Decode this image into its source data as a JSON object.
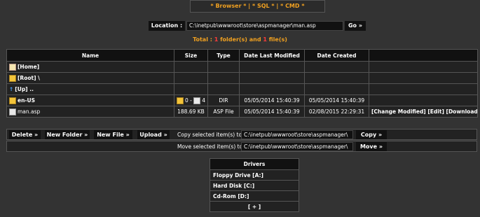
{
  "nav": {
    "browser": "* Browser *",
    "sep1": " | ",
    "sql": "* SQL *",
    "sep2": " | ",
    "cmd": "* CMD *"
  },
  "location": {
    "label": "Location :",
    "value": "C:\\inetpub\\wwwroot\\store\\aspmanager\\man.asp",
    "go": "Go »"
  },
  "total": {
    "prefix": "Total : ",
    "folders": "1",
    "mid": " folder(s) and ",
    "files": "1",
    "suffix": " file(s)"
  },
  "table": {
    "headers": [
      "Name",
      "Size",
      "Type",
      "Date Last Modified",
      "Date Created",
      ""
    ],
    "nav_rows": [
      "[Home]",
      "[Root] \\",
      "[Up] .."
    ],
    "rows": [
      {
        "name": "en-US",
        "size_folders": "0",
        "size_sep": " - ",
        "size_files": "4",
        "type": "DIR",
        "modified": "05/05/2014 15:40:39",
        "created": "05/05/2014 15:40:39",
        "actions": []
      },
      {
        "name": "man.asp",
        "size": "188.69 KB",
        "type": "ASP File",
        "modified": "05/05/2014 15:40:39",
        "created": "02/08/2015 22:29:31",
        "actions": [
          "[Change Modified]",
          "[Edit]",
          "[Download]"
        ]
      }
    ]
  },
  "ops": {
    "delete": "Delete »",
    "new_folder": "New Folder »",
    "new_file": "New File »",
    "upload": "Upload »",
    "copy_label": "Copy selected item(s) to :",
    "copy_value": "C:\\inetpub\\wwwroot\\store\\aspmanager\\",
    "copy_btn": "Copy »",
    "move_label": "Move selected item(s) to :",
    "move_value": "C:\\inetpub\\wwwroot\\store\\aspmanager\\",
    "move_btn": "Move »"
  },
  "drivers": {
    "title": "Drivers",
    "items": [
      "Floppy Drive [A:]",
      "Hard Disk [C:]",
      "Cd-Rom [D:]"
    ],
    "more": "[ + ]"
  },
  "colors": {
    "background": "#333333",
    "accent": "#f0a020",
    "count": "#ff3b3b"
  }
}
